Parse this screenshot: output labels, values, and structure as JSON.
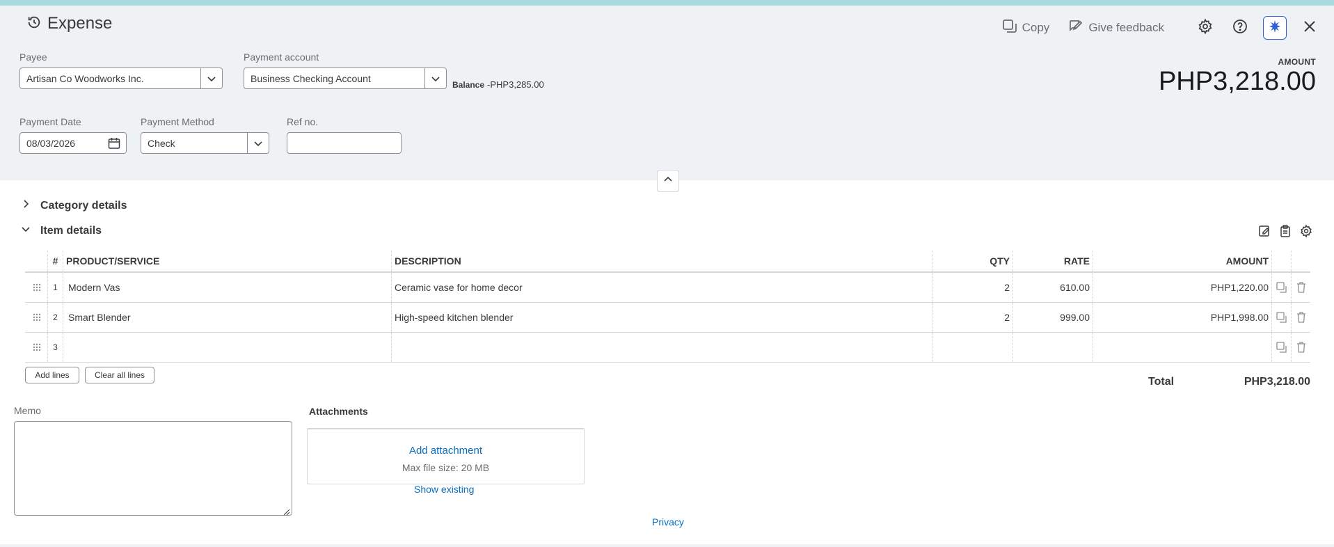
{
  "header": {
    "title": "Expense",
    "copy_label": "Copy",
    "feedback_label": "Give feedback",
    "amount_label": "AMOUNT",
    "amount_value": "PHP3,218.00"
  },
  "form": {
    "payee": {
      "label": "Payee",
      "value": "Artisan Co Woodworks Inc."
    },
    "payment_account": {
      "label": "Payment account",
      "value": "Business Checking Account"
    },
    "balance": {
      "label": "Balance",
      "value": "-PHP3,285.00"
    },
    "payment_date": {
      "label": "Payment Date",
      "value": "08/03/2026"
    },
    "payment_method": {
      "label": "Payment Method",
      "value": "Check"
    },
    "ref_no": {
      "label": "Ref no.",
      "value": ""
    }
  },
  "sections": {
    "category": "Category details",
    "item": "Item details"
  },
  "table": {
    "headers": {
      "num": "#",
      "product": "PRODUCT/SERVICE",
      "description": "DESCRIPTION",
      "qty": "QTY",
      "rate": "RATE",
      "amount": "AMOUNT"
    },
    "rows": [
      {
        "num": "1",
        "product": "Modern Vas",
        "description": "Ceramic vase for home decor",
        "qty": "2",
        "rate": "610.00",
        "amount": "PHP1,220.00"
      },
      {
        "num": "2",
        "product": "Smart Blender",
        "description": "High-speed kitchen blender",
        "qty": "2",
        "rate": "999.00",
        "amount": "PHP1,998.00"
      },
      {
        "num": "3",
        "product": "",
        "description": "",
        "qty": "",
        "rate": "",
        "amount": ""
      }
    ],
    "add_lines": "Add lines",
    "clear_lines": "Clear all lines",
    "total_label": "Total",
    "total_value": "PHP3,218.00"
  },
  "memo": {
    "label": "Memo",
    "value": ""
  },
  "attachments": {
    "label": "Attachments",
    "add": "Add attachment",
    "max_size": "Max file size: 20 MB",
    "show_existing": "Show existing"
  },
  "footer": {
    "privacy": "Privacy"
  },
  "colors": {
    "accent_link": "#0a6ebd",
    "header_bg": "#eef2f5",
    "top_strip": "#a9d8de",
    "ai_border": "#2f60d6"
  },
  "icons": [
    "history-icon",
    "copy-icon",
    "feedback-icon",
    "gear-icon",
    "help-icon",
    "ai-assistant-icon",
    "close-icon",
    "chevron-down-icon",
    "calendar-icon",
    "chevron-up-icon",
    "chevron-right-icon",
    "drag-handle-icon",
    "duplicate-icon",
    "trash-icon",
    "edit-icon",
    "paste-icon"
  ]
}
